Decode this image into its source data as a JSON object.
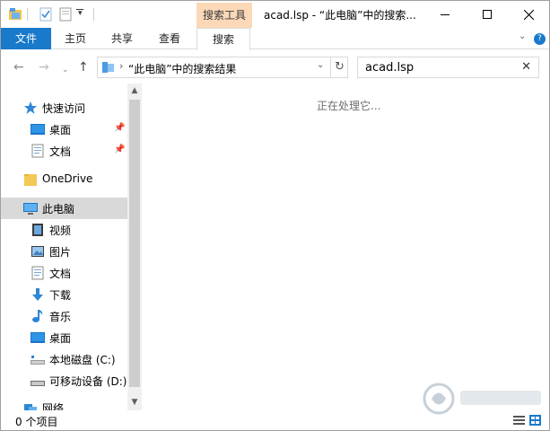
{
  "window": {
    "title": "acad.lsp - “此电脑”中的搜索...",
    "context_tab": "搜索工具"
  },
  "ribbon": {
    "file": "文件",
    "tabs": [
      "主页",
      "共享",
      "查看",
      "搜索"
    ],
    "active_tab": "搜索"
  },
  "address": {
    "path": "“此电脑”中的搜索结果",
    "search_value": "acad.lsp"
  },
  "nav": {
    "quick_access": "快速访问",
    "desktop": "桌面",
    "documents": "文档",
    "onedrive": "OneDrive",
    "this_pc": "此电脑",
    "videos": "视频",
    "pictures": "图片",
    "documents2": "文档",
    "downloads": "下载",
    "music": "音乐",
    "desktop2": "桌面",
    "local_disk": "本地磁盘 (C:)",
    "removable": "可移动设备 (D:)",
    "network": "网络"
  },
  "content": {
    "status_message": "正在处理它..."
  },
  "statusbar": {
    "item_count": "0 个项目"
  },
  "colors": {
    "accent": "#1979ca",
    "context_tab": "#fbd9b8",
    "selected_nav": "#d9d9d9"
  }
}
